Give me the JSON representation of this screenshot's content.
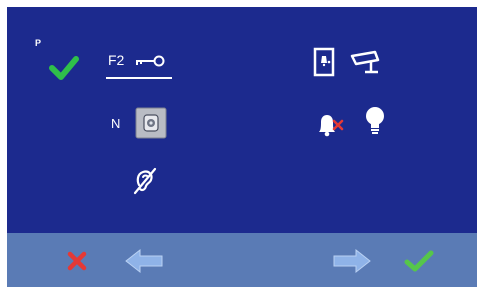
{
  "status": {
    "mode_label": "P"
  },
  "function": {
    "key_label": "F2",
    "selected": true
  },
  "profile": {
    "letter": "N"
  },
  "icons": {
    "check": "check-icon",
    "key": "key-icon",
    "door": "door-icon",
    "camera": "cctv-camera-icon",
    "handset": "handset-icon",
    "bell_muted": "bell-muted-icon",
    "bulb": "light-bulb-icon",
    "hearing": "hearing-loop-icon"
  },
  "bottom_bar": {
    "cancel": "cancel-icon",
    "prev": "arrow-left-icon",
    "next": "arrow-right-icon",
    "confirm": "confirm-icon"
  },
  "colors": {
    "background": "#1c2a8e",
    "bar": "#5a7bb5",
    "accent_green": "#2fbf4a",
    "cancel_red": "#e53935",
    "arrow_blue": "#8fb3e8"
  }
}
